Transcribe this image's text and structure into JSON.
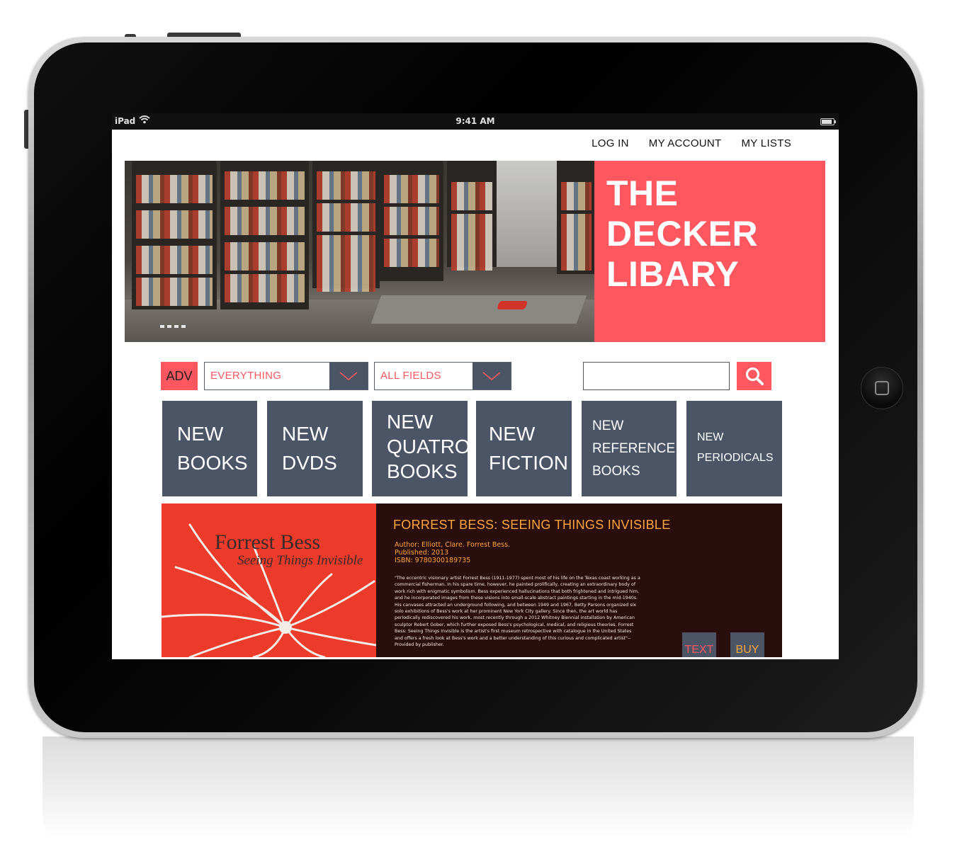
{
  "status_bar": {
    "carrier": "iPad",
    "time": "9:41 AM"
  },
  "top_nav": {
    "login": "LOG IN",
    "account": "MY ACCOUNT",
    "lists": "MY LISTS"
  },
  "hero": {
    "title_lines": [
      "THE",
      "DECKER",
      "LIBARY"
    ]
  },
  "search": {
    "adv_label": "ADV",
    "scope_value": "EVERYTHING",
    "field_value": "ALL FIELDS",
    "query": ""
  },
  "tiles": [
    {
      "lines": [
        "NEW",
        "BOOKS"
      ]
    },
    {
      "lines": [
        "NEW",
        "DVDS"
      ]
    },
    {
      "lines": [
        "NEW",
        "QUATRO",
        "BOOKS"
      ]
    },
    {
      "lines": [
        "NEW",
        "FICTION"
      ]
    },
    {
      "lines": [
        "NEW",
        "REFERENCE",
        "BOOKS"
      ]
    },
    {
      "lines": [
        "NEW",
        "PERIODICALS"
      ]
    }
  ],
  "featured": {
    "cover_title": "Forrest Bess",
    "cover_subtitle": "Seeing Things Invisible",
    "title": "FORREST BESS: SEEING THINGS INVISIBLE",
    "author": "Author: Elliott, Clare. Forrest Bess.",
    "published": "Published: 2013",
    "isbn": "ISBN: 9780300189735",
    "description": "\"The eccentric visionary artist Forrest Bess (1911-1977) spent most of his life on the Texas coast working as a commercial fisherman. In his spare time, however, he painted prolifically, creating an extraordinary body of work rich with enigmatic symbolism. Bess experienced hallucinations that both frightened and intrigued him, and he incorporated images from these visions into small-scale abstract paintings starting in the mid-1940s. His canvases attracted an underground following, and between 1949 and 1967, Betty Parsons organized six solo exhibitions of Bess's work at her prominent New York City gallery. Since then, the art world has periodically rediscovered his work, most recently through a 2012 Whitney Biennial installation by American sculptor Robert Gober, which further exposed Bess's psychological, medical, and religious theories. Forrest Bess: Seeing Things Invisible is the artist's first museum retrospective with catalogue in the United States and offers a fresh look at Bess's work and a better understanding of this curious and complicated artist\"-- Provided by publisher.",
    "text_button": "TEXT",
    "buy_button": "BUY"
  },
  "colors": {
    "accent": "#fe575f",
    "tile": "#4c5566",
    "featured_bg": "#2a0e0d",
    "featured_text": "#ffa53e"
  },
  "icons": {
    "search": "magnifier-icon",
    "dropdown": "chevron-down-icon",
    "wifi": "wifi-icon",
    "battery": "battery-icon"
  }
}
